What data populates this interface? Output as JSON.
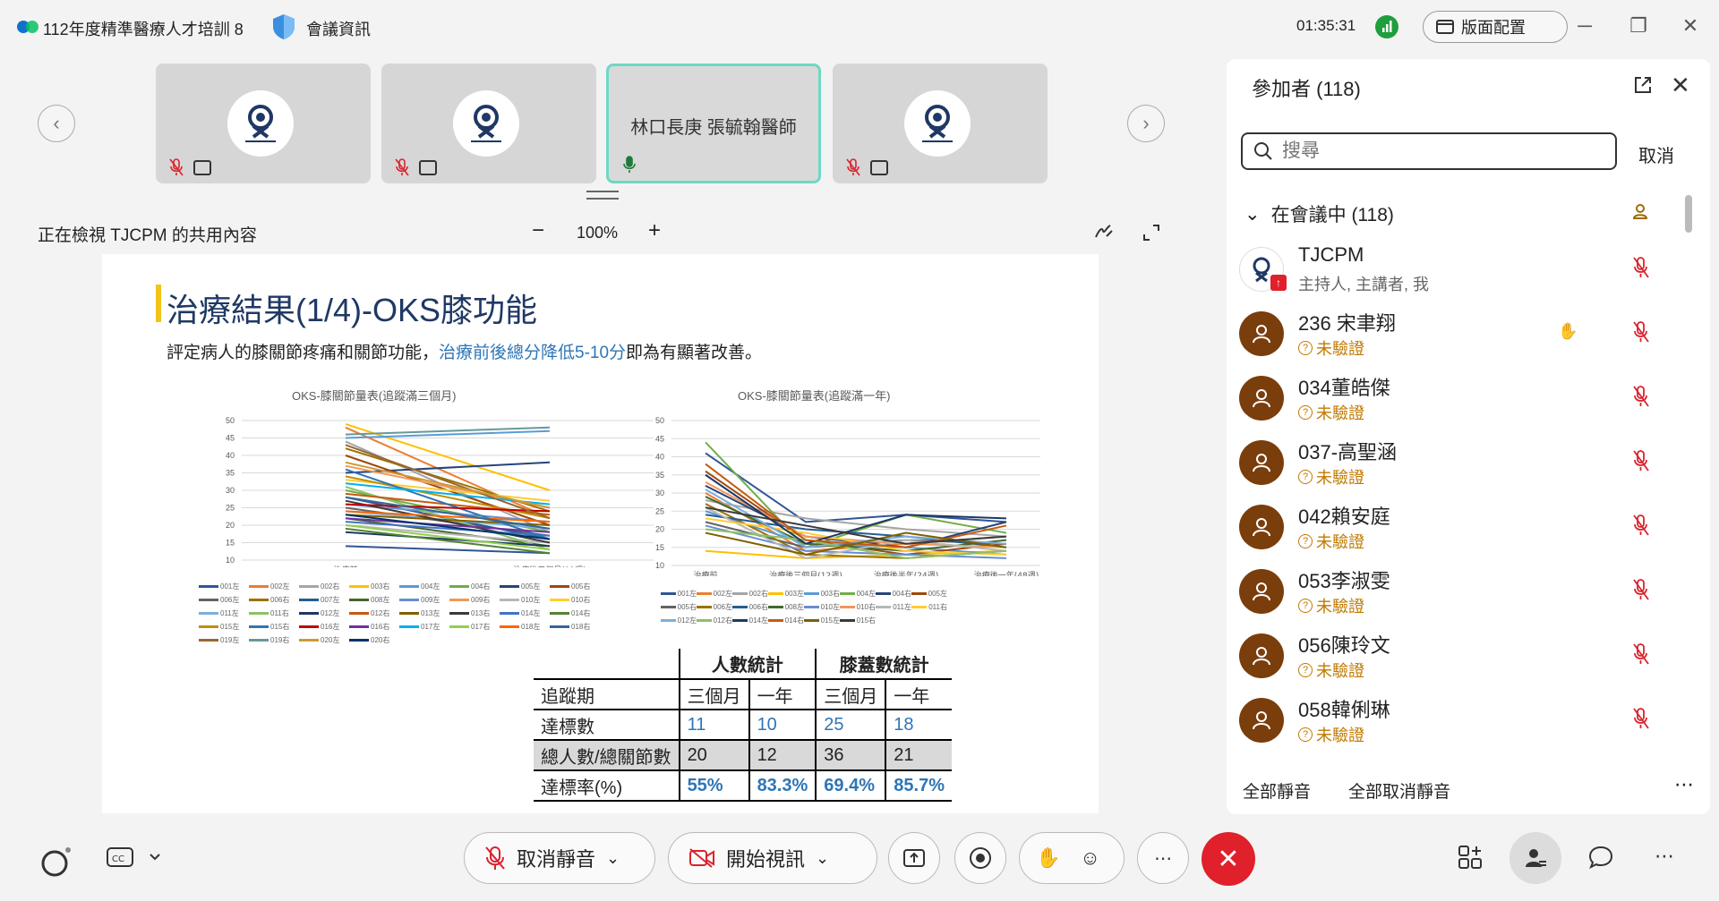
{
  "titlebar": {
    "title": "112年度精準醫療人才培訓 8",
    "meeting_info": "會議資訊",
    "clock": "01:35:31",
    "layout_button": "版面配置"
  },
  "video_strip": {
    "tiles": [
      {
        "type": "logo",
        "muted": true
      },
      {
        "type": "logo",
        "muted": true
      },
      {
        "type": "name",
        "name": "林口長庚 張毓翰醫師",
        "active": true
      },
      {
        "type": "logo",
        "muted": true
      }
    ]
  },
  "share_header": {
    "viewing_text": "正在檢視 TJCPM 的共用內容",
    "zoom": "100%",
    "zoom_minus": "−",
    "zoom_plus": "+"
  },
  "slide": {
    "title": "治療結果(1/4)-OKS膝功能",
    "subtitle_pre": "評定病人的膝關節疼痛和關節功能，",
    "subtitle_highlight": "治療前後總分降低5-10分",
    "subtitle_post": "即為有顯著改善。",
    "table": {
      "group_headers": [
        "人數統計",
        "膝蓋數統計"
      ],
      "sub_headers": [
        "追蹤期",
        "三個月",
        "一年",
        "三個月",
        "一年"
      ],
      "rows": [
        {
          "label": "達標數",
          "values": [
            "11",
            "10",
            "25",
            "18"
          ]
        },
        {
          "label": "總人數/總關節數",
          "values": [
            "20",
            "12",
            "36",
            "21"
          ]
        },
        {
          "label": "達標率(%)",
          "values": [
            "55%",
            "83.3%",
            "69.4%",
            "85.7%"
          ]
        }
      ]
    }
  },
  "chart_data": [
    {
      "type": "line",
      "title": "OKS-膝關節量表(追蹤滿三個月)",
      "categories": [
        "治療前",
        "治療後三個月(12週)"
      ],
      "ylim": [
        10,
        50
      ],
      "yticks": [
        10,
        15,
        20,
        25,
        30,
        35,
        40,
        45,
        50
      ],
      "series": [
        {
          "name": "001左",
          "values": [
            14,
            12
          ]
        },
        {
          "name": "002左",
          "values": [
            48,
            22
          ]
        },
        {
          "name": "002右",
          "values": [
            44,
            18
          ]
        },
        {
          "name": "003右",
          "values": [
            49,
            30
          ]
        },
        {
          "name": "004左",
          "values": [
            45,
            47
          ]
        },
        {
          "name": "004右",
          "values": [
            30,
            18
          ]
        },
        {
          "name": "005左",
          "values": [
            35,
            38
          ]
        },
        {
          "name": "005右",
          "values": [
            40,
            20
          ]
        },
        {
          "name": "006左",
          "values": [
            25,
            17
          ]
        },
        {
          "name": "006右",
          "values": [
            42,
            24
          ]
        },
        {
          "name": "007左",
          "values": [
            28,
            16
          ]
        },
        {
          "name": "008左",
          "values": [
            22,
            14
          ]
        },
        {
          "name": "009左",
          "values": [
            26,
            21
          ]
        },
        {
          "name": "009右",
          "values": [
            37,
            25
          ]
        },
        {
          "name": "010左",
          "values": [
            20,
            15
          ]
        },
        {
          "name": "010右",
          "values": [
            33,
            27
          ]
        },
        {
          "name": "011左",
          "values": [
            24,
            19
          ]
        },
        {
          "name": "011右",
          "values": [
            31,
            13
          ]
        },
        {
          "name": "012左",
          "values": [
            18,
            14
          ]
        },
        {
          "name": "012右",
          "values": [
            29,
            23
          ]
        },
        {
          "name": "013左",
          "values": [
            23,
            20
          ]
        },
        {
          "name": "013右",
          "values": [
            27,
            15
          ]
        },
        {
          "name": "014左",
          "values": [
            21,
            17
          ]
        },
        {
          "name": "014右",
          "values": [
            19,
            12
          ]
        },
        {
          "name": "015左",
          "values": [
            34,
            22
          ]
        },
        {
          "name": "015右",
          "values": [
            36,
            16
          ]
        },
        {
          "name": "016左",
          "values": [
            26,
            24
          ]
        },
        {
          "name": "016右",
          "values": [
            22,
            18
          ]
        },
        {
          "name": "017左",
          "values": [
            32,
            26
          ]
        },
        {
          "name": "017右",
          "values": [
            20,
            13
          ]
        },
        {
          "name": "018左",
          "values": [
            24,
            21
          ]
        },
        {
          "name": "018右",
          "values": [
            28,
            19
          ]
        },
        {
          "name": "019左",
          "values": [
            43,
            22
          ]
        },
        {
          "name": "019右",
          "values": [
            46,
            48
          ]
        },
        {
          "name": "020左",
          "values": [
            38,
            25
          ]
        },
        {
          "name": "020右",
          "values": [
            23,
            16
          ]
        }
      ]
    },
    {
      "type": "line",
      "title": "OKS-膝關節量表(追蹤滿一年)",
      "categories": [
        "治療前",
        "治療後三個月(12週)",
        "治療後半年(24週)",
        "治療後一年(48週)"
      ],
      "ylim": [
        10,
        50
      ],
      "yticks": [
        10,
        15,
        20,
        25,
        30,
        35,
        40,
        45,
        50
      ],
      "series": [
        {
          "name": "001左",
          "values": [
            41,
            22,
            24,
            22
          ]
        },
        {
          "name": "002左",
          "values": [
            30,
            14,
            16,
            18
          ]
        },
        {
          "name": "002右",
          "values": [
            28,
            23,
            20,
            18
          ]
        },
        {
          "name": "003左",
          "values": [
            14,
            12,
            13,
            14
          ]
        },
        {
          "name": "003右",
          "values": [
            25,
            16,
            15,
            13
          ]
        },
        {
          "name": "004左",
          "values": [
            44,
            15,
            24,
            19
          ]
        },
        {
          "name": "004右",
          "values": [
            32,
            18,
            15,
            22
          ]
        },
        {
          "name": "005左",
          "values": [
            36,
            17,
            13,
            16
          ]
        },
        {
          "name": "005右",
          "values": [
            22,
            15,
            17,
            16
          ]
        },
        {
          "name": "006左",
          "values": [
            27,
            13,
            12,
            14
          ]
        },
        {
          "name": "006右",
          "values": [
            24,
            20,
            18,
            15
          ]
        },
        {
          "name": "008左",
          "values": [
            29,
            16,
            14,
            17
          ]
        },
        {
          "name": "010左",
          "values": [
            21,
            14,
            13,
            12
          ]
        },
        {
          "name": "010右",
          "values": [
            33,
            18,
            16,
            15
          ]
        },
        {
          "name": "011左",
          "values": [
            26,
            12,
            17,
            14
          ]
        },
        {
          "name": "011右",
          "values": [
            23,
            19,
            14,
            13
          ]
        },
        {
          "name": "012左",
          "values": [
            31,
            15,
            18,
            16
          ]
        },
        {
          "name": "012右",
          "values": [
            20,
            17,
            12,
            14
          ]
        },
        {
          "name": "014左",
          "values": [
            35,
            16,
            24,
            23
          ]
        },
        {
          "name": "014右",
          "values": [
            38,
            17,
            15,
            21
          ]
        },
        {
          "name": "015左",
          "values": [
            19,
            13,
            19,
            15
          ]
        },
        {
          "name": "015右",
          "values": [
            26,
            21,
            16,
            18
          ]
        }
      ]
    }
  ],
  "participants": {
    "title": "參加者 (118)",
    "search_placeholder": "搜尋",
    "cancel": "取消",
    "section": "在會議中 (118)",
    "list": [
      {
        "name": "TJCPM",
        "status": "主持人, 主講者, 我",
        "host": true
      },
      {
        "name": "236 宋聿翔",
        "status": "未驗證",
        "hand": true
      },
      {
        "name": "034董皓傑",
        "status": "未驗證"
      },
      {
        "name": "037-高聖涵",
        "status": "未驗證"
      },
      {
        "name": "042賴安庭",
        "status": "未驗證"
      },
      {
        "name": "053李淑雯",
        "status": "未驗證"
      },
      {
        "name": "056陳玲文",
        "status": "未驗證"
      },
      {
        "name": "058韓俐琳",
        "status": "未驗證"
      }
    ],
    "mute_all": "全部靜音",
    "unmute_all": "全部取消靜音"
  },
  "toolbar": {
    "unmute": "取消靜音",
    "start_video": "開始視訊"
  },
  "colors": {
    "accent": "#2e75b6",
    "end_call": "#e0202a",
    "avatar": "#7a3d0c",
    "active_tile": "#6fd8c4"
  }
}
